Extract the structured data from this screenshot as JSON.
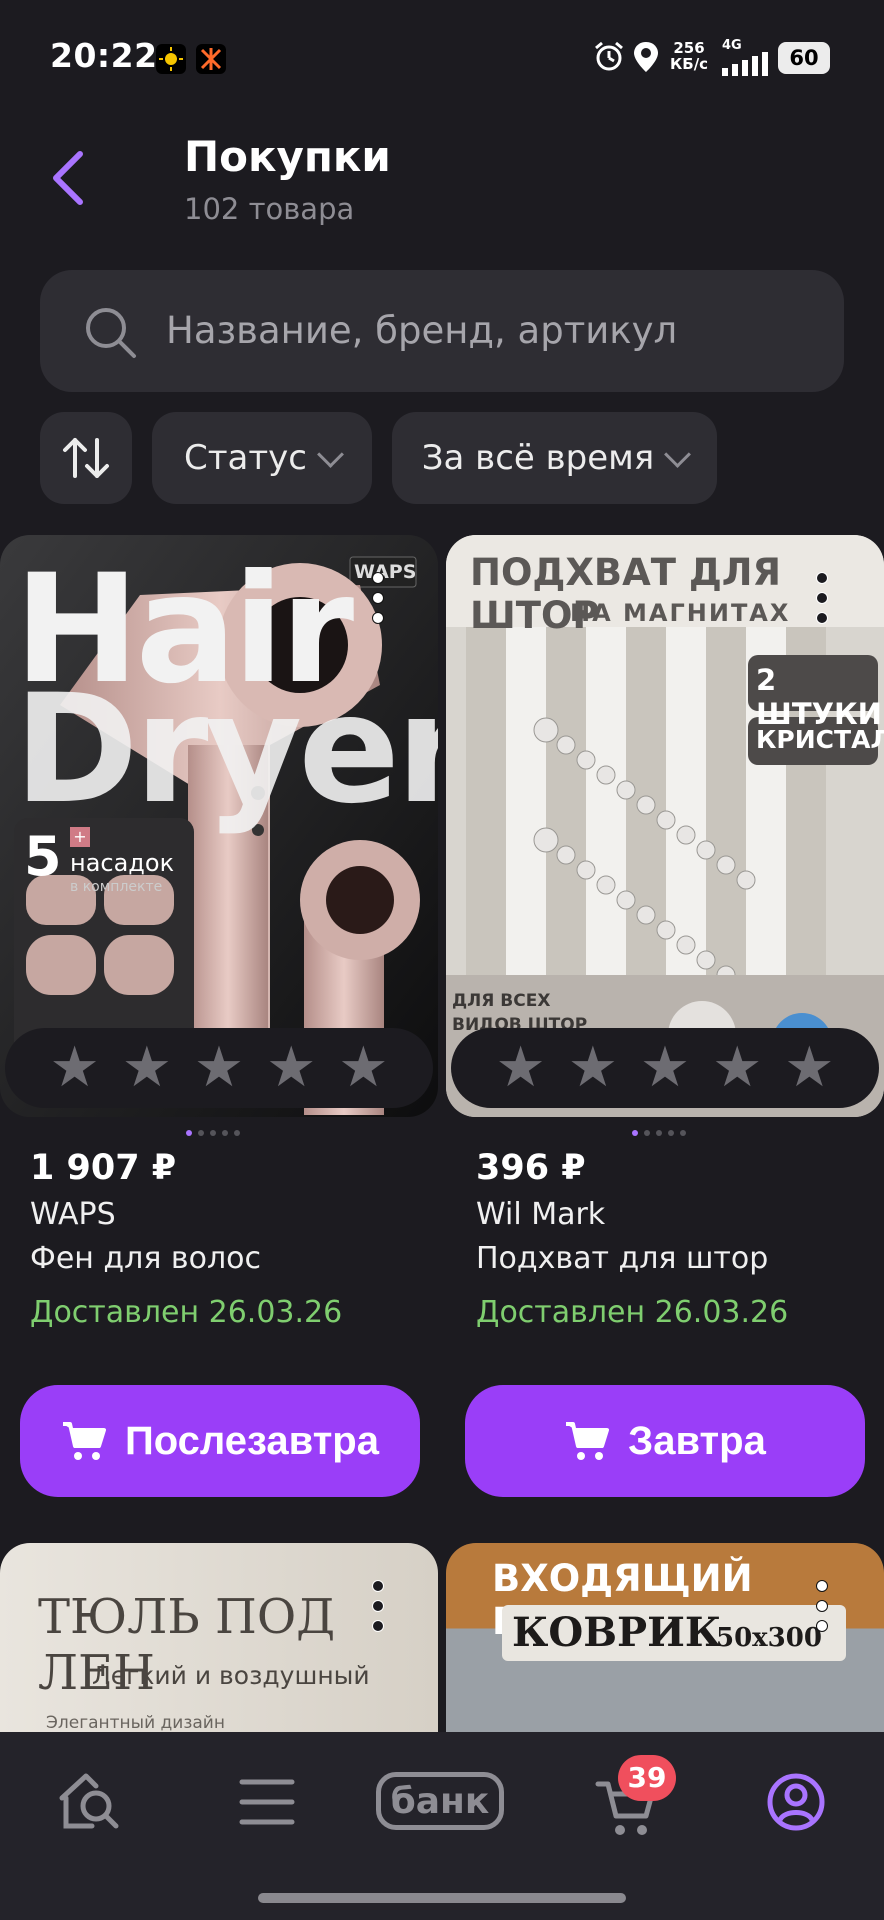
{
  "status_bar": {
    "time": "20:22",
    "speed_value": "256",
    "speed_unit": "КБ/с",
    "network": "4G",
    "battery": "60"
  },
  "header": {
    "title": "Покупки",
    "subtitle": "102 товара"
  },
  "search": {
    "placeholder": "Название, бренд, артикул"
  },
  "filters": {
    "status_label": "Статус",
    "period_label": "За всё время"
  },
  "products": [
    {
      "price": "1 907 ₽",
      "brand": "WAPS",
      "name": "Фен для волос",
      "status": "Доставлен 26.03.26",
      "button_label": "Послезавтра",
      "image_text": {
        "hero_line1": "Hair",
        "hero_line2": "Dryer",
        "logo": "WAPS",
        "badge_count": "5",
        "badge_plus": "+",
        "badge_line1": "насадок",
        "badge_line2": "в комплекте"
      }
    },
    {
      "price": "396 ₽",
      "brand": "Wil Mark",
      "name": "Подхват для штор",
      "status": "Доставлен 26.03.26",
      "button_label": "Завтра",
      "image_text": {
        "line1": "ПОДХВАТ ДЛЯ ШТОР",
        "line2": "НА МАГНИТАХ",
        "tag1": "2 ШТУКИ",
        "tag2": "КРИСТАЛЛ",
        "corner_line1": "ДЛЯ ВСЕХ",
        "corner_line2": "ВИДОВ ШТОР"
      }
    }
  ],
  "previews": [
    {
      "line1": "ТЮЛЬ ПОД ЛЕН",
      "line2": "Легкий и воздушный",
      "line3": "Элегантный дизайн"
    },
    {
      "line1": "ВХОДЯЩИЙ ВЫЗОВ",
      "line2": "КОВРИК",
      "line3": "50х300"
    }
  ],
  "bottom_nav": {
    "bank_label": "банк",
    "cart_badge": "39"
  }
}
